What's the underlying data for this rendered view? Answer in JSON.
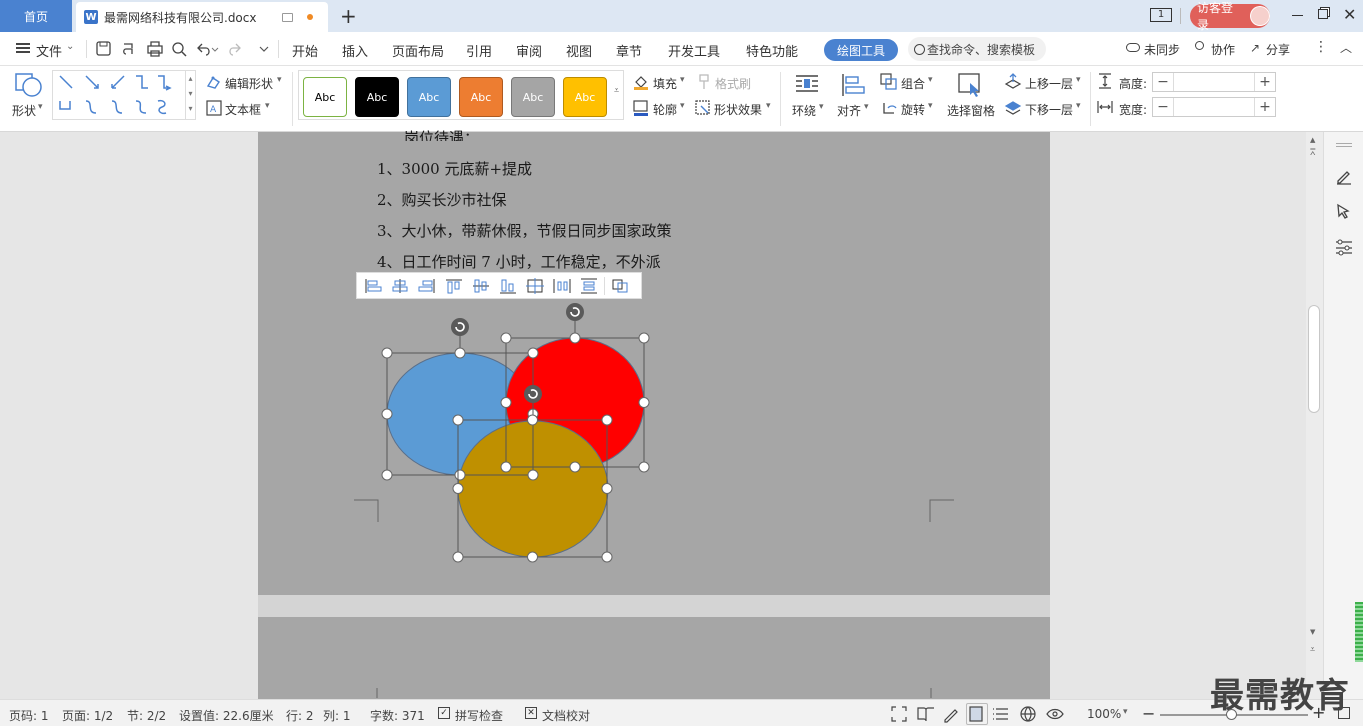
{
  "titlebar": {
    "home_tab": "首页",
    "doc_tab": "最需网络科技有限公司.docx",
    "doc_icon": "W",
    "new_tab": "+",
    "page_indicator": "1",
    "login": "访客登录"
  },
  "menu": {
    "file": "文件",
    "tabs": [
      "开始",
      "插入",
      "页面布局",
      "引用",
      "审阅",
      "视图",
      "章节",
      "开发工具",
      "特色功能"
    ],
    "active_tab": "绘图工具",
    "search_placeholder": "查找命令、搜索模板",
    "sync": "未同步",
    "collab": "协作",
    "share": "分享"
  },
  "ribbon": {
    "shape_label": "形状",
    "edit_shape": "编辑形状",
    "text_box": "文本框",
    "styles": [
      {
        "text": "Abc",
        "bg": "#ffffff",
        "fg": "#000000",
        "border": "#7cb342"
      },
      {
        "text": "Abc",
        "bg": "#000000",
        "fg": "#ffffff",
        "border": "#000000"
      },
      {
        "text": "Abc",
        "bg": "#5b9bd5",
        "fg": "#ffffff",
        "border": "#41719c"
      },
      {
        "text": "Abc",
        "bg": "#ed7d31",
        "fg": "#ffffff",
        "border": "#ae5a21"
      },
      {
        "text": "Abc",
        "bg": "#a5a5a5",
        "fg": "#ffffff",
        "border": "#787878"
      },
      {
        "text": "Abc",
        "bg": "#ffc000",
        "fg": "#ffffff",
        "border": "#bc8c00"
      }
    ],
    "fill": "填充",
    "format_painter": "格式刷",
    "outline": "轮廓",
    "shape_effect": "形状效果",
    "wrap": "环绕",
    "align": "对齐",
    "group": "组合",
    "rotate": "旋转",
    "select_pane": "选择窗格",
    "bring_forward": "上移一层",
    "send_backward": "下移一层",
    "height_label": "高度:",
    "width_label": "宽度:",
    "height_value": "",
    "width_value": ""
  },
  "document": {
    "lines": [
      "岗位待遇：",
      "1、3000 元底薪+提成",
      "2、购买长沙市社保",
      "3、大小休，带薪休假，节假日同步国家政策",
      "4、日工作时间 7 小时，工作稳定，不外派"
    ]
  },
  "shapes": {
    "colors": [
      "#5b9bd5",
      "#ff0000",
      "#bf9000"
    ]
  },
  "status": {
    "page_num": "页码: 1",
    "pages": "页面: 1/2",
    "section": "节: 2/2",
    "setting": "设置值: 22.6厘米",
    "row": "行: 2",
    "col": "列: 1",
    "word_count": "字数: 371",
    "spell": "拼写检查",
    "proof": "文档校对",
    "zoom": "100%"
  },
  "watermark": "最需教育"
}
